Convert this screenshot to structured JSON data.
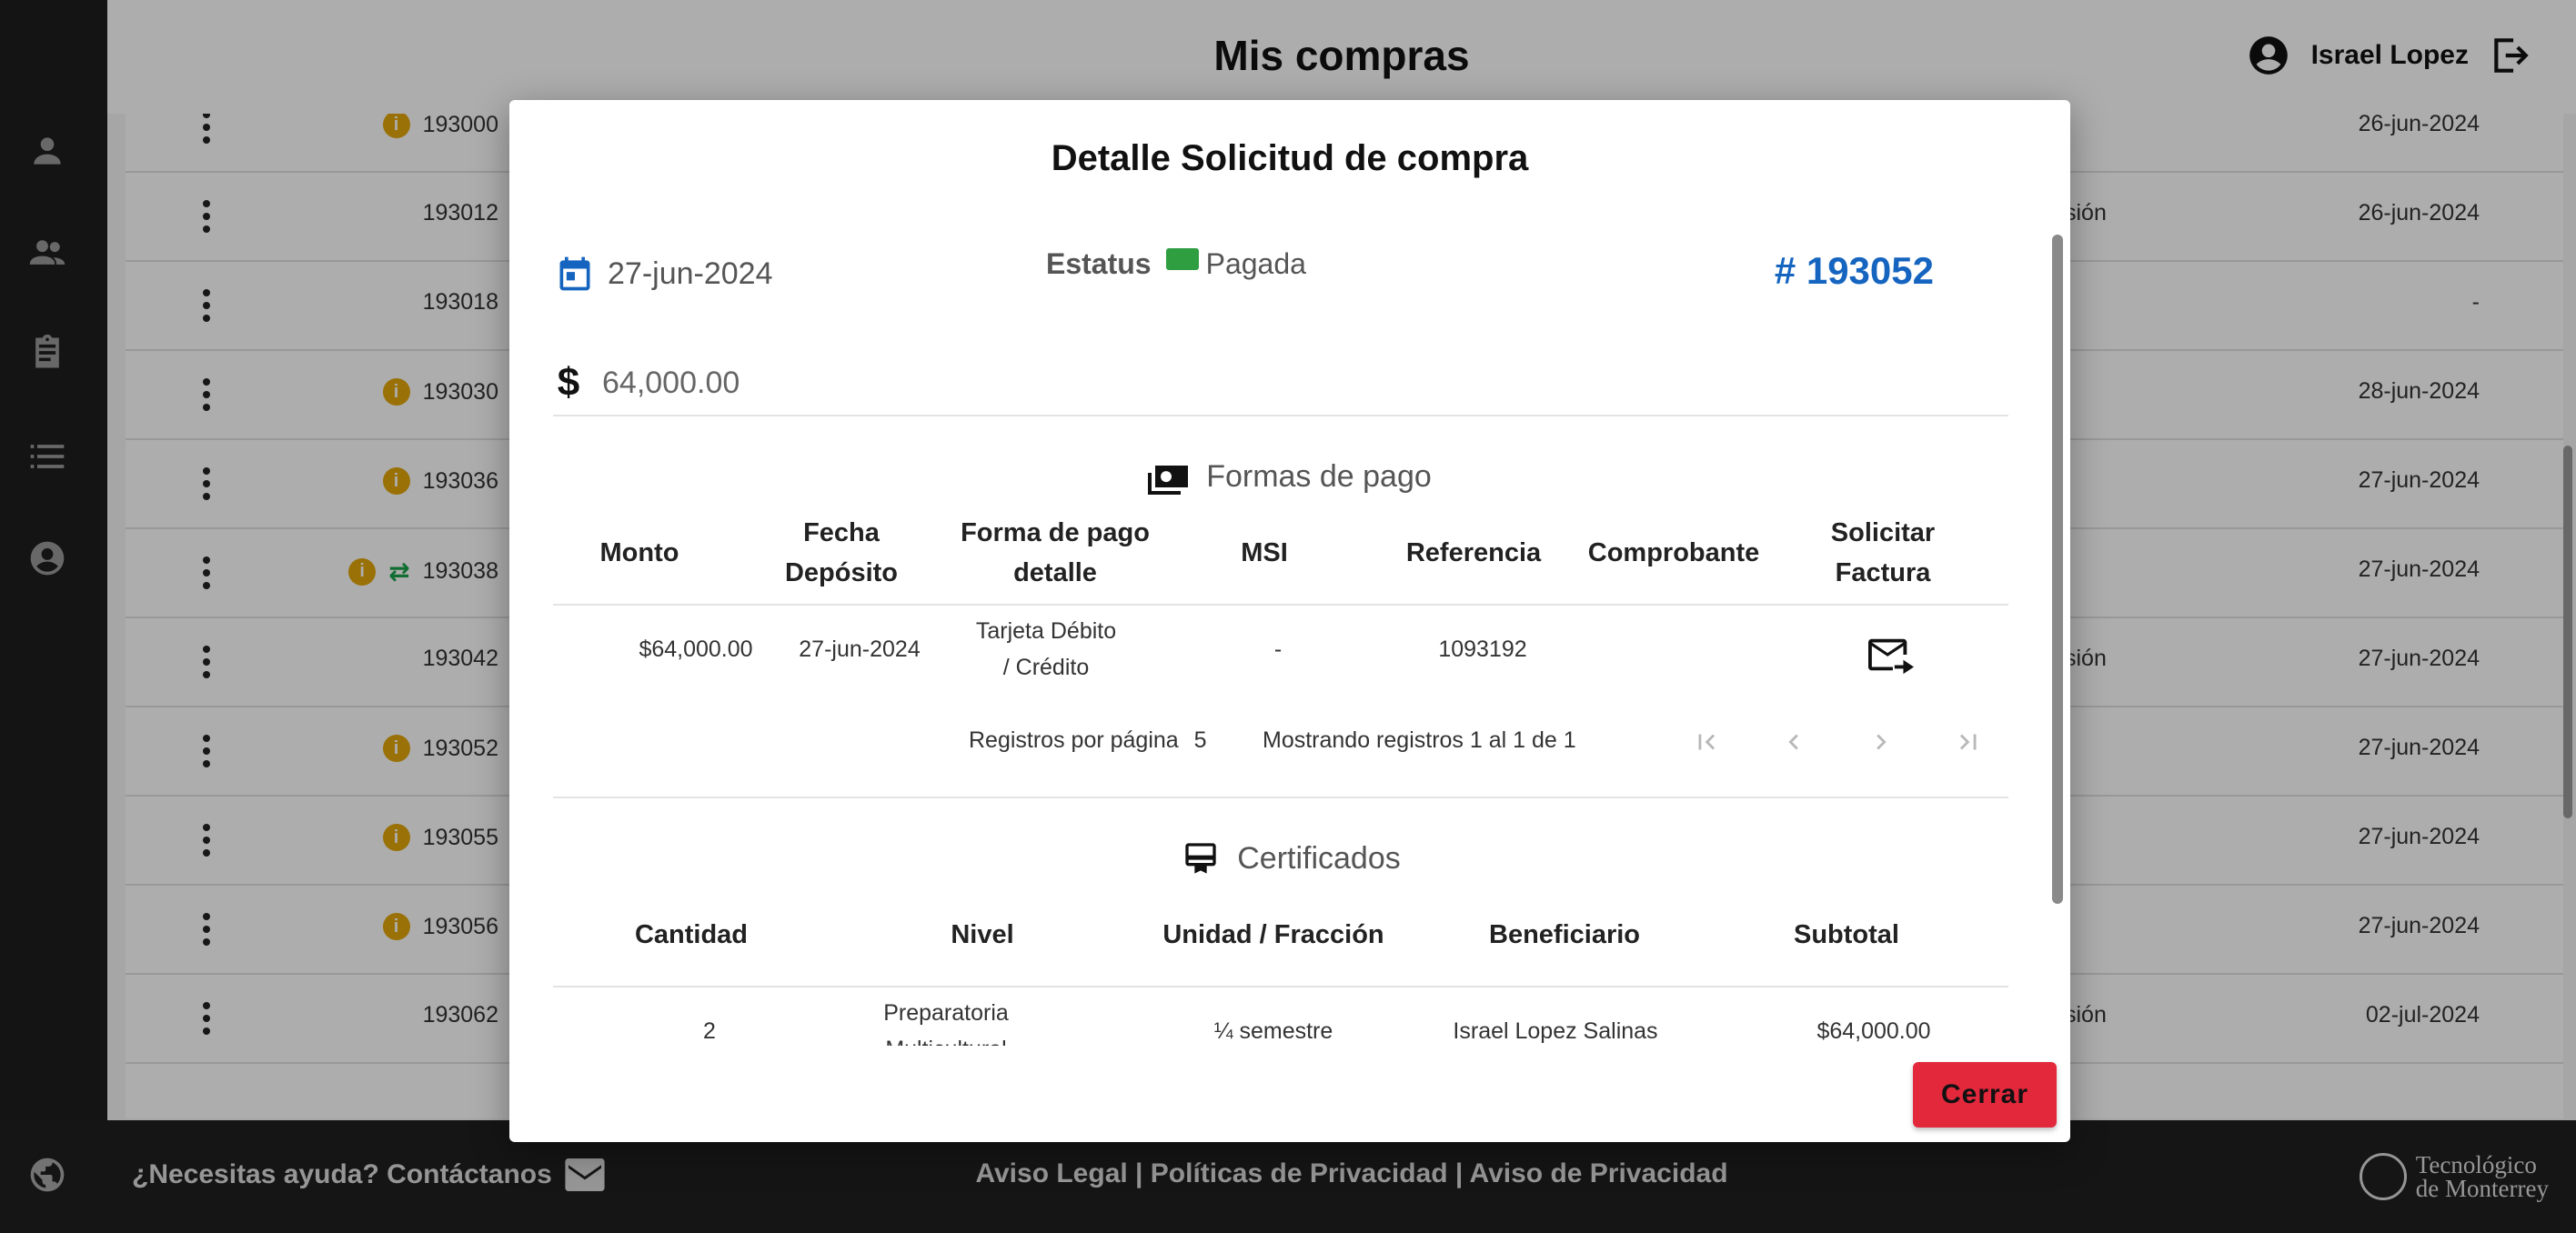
{
  "header": {
    "title": "Mis compras",
    "user_name": "Israel Lopez"
  },
  "sidebar": {
    "icons": [
      "person-icon",
      "group-icon",
      "assignment-icon",
      "list-icon",
      "account-circle-icon"
    ]
  },
  "background_table": {
    "rows": [
      {
        "id": "193000",
        "info": true,
        "swap": false,
        "date": "26-jun-2024",
        "extra": ""
      },
      {
        "id": "193012",
        "info": false,
        "swap": false,
        "date": "26-jun-2024",
        "extra": "sión"
      },
      {
        "id": "193018",
        "info": false,
        "swap": false,
        "date": "-",
        "extra": ""
      },
      {
        "id": "193030",
        "info": true,
        "swap": false,
        "date": "28-jun-2024",
        "extra": ""
      },
      {
        "id": "193036",
        "info": true,
        "swap": false,
        "date": "27-jun-2024",
        "extra": ""
      },
      {
        "id": "193038",
        "info": true,
        "swap": true,
        "date": "27-jun-2024",
        "extra": ""
      },
      {
        "id": "193042",
        "info": false,
        "swap": false,
        "date": "27-jun-2024",
        "extra": "sión"
      },
      {
        "id": "193052",
        "info": true,
        "swap": false,
        "date": "27-jun-2024",
        "extra": ""
      },
      {
        "id": "193055",
        "info": true,
        "swap": false,
        "date": "27-jun-2024",
        "extra": ""
      },
      {
        "id": "193056",
        "info": true,
        "swap": false,
        "date": "27-jun-2024",
        "extra": ""
      },
      {
        "id": "193062",
        "info": false,
        "swap": false,
        "date": "02-jul-2024",
        "extra": "sión"
      }
    ]
  },
  "modal": {
    "title": "Detalle Solicitud de compra",
    "date": "27-jun-2024",
    "status_label": "Estatus",
    "status_value": "Pagada",
    "order_number": "# 193052",
    "amount": "64,000.00",
    "payments_section": "Formas de pago",
    "payments_headers": [
      "Monto",
      "Fecha\nDepósito",
      "Forma de pago\ndetalle",
      "MSI",
      "Referencia",
      "Comprobante",
      "Solicitar\nFactura"
    ],
    "payments_rows": [
      {
        "monto": "$64,000.00",
        "fecha": "27-jun-2024",
        "forma": "Tarjeta Débito\n/ Crédito",
        "msi": "-",
        "referencia": "1093192"
      }
    ],
    "per_page_label": "Registros por página",
    "per_page_value": "5",
    "showing": "Mostrando registros 1 al 1 de 1",
    "certificates_section": "Certificados",
    "cert_headers": [
      "Cantidad",
      "Nivel",
      "Unidad / Fracción",
      "Beneficiario",
      "Subtotal"
    ],
    "cert_rows": [
      {
        "cantidad": "2",
        "nivel": "Preparatoria\nMulticultural",
        "unidad": "¼ semestre",
        "beneficiario": "Israel Lopez Salinas",
        "subtotal": "$64,000.00"
      }
    ],
    "close_label": "Cerrar"
  },
  "footer": {
    "help": "¿Necesitas ayuda? Contáctanos",
    "legal": "Aviso Legal | Políticas de Privacidad | Aviso de Privacidad",
    "brand_line1": "Tecnológico",
    "brand_line2": "de Monterrey"
  }
}
